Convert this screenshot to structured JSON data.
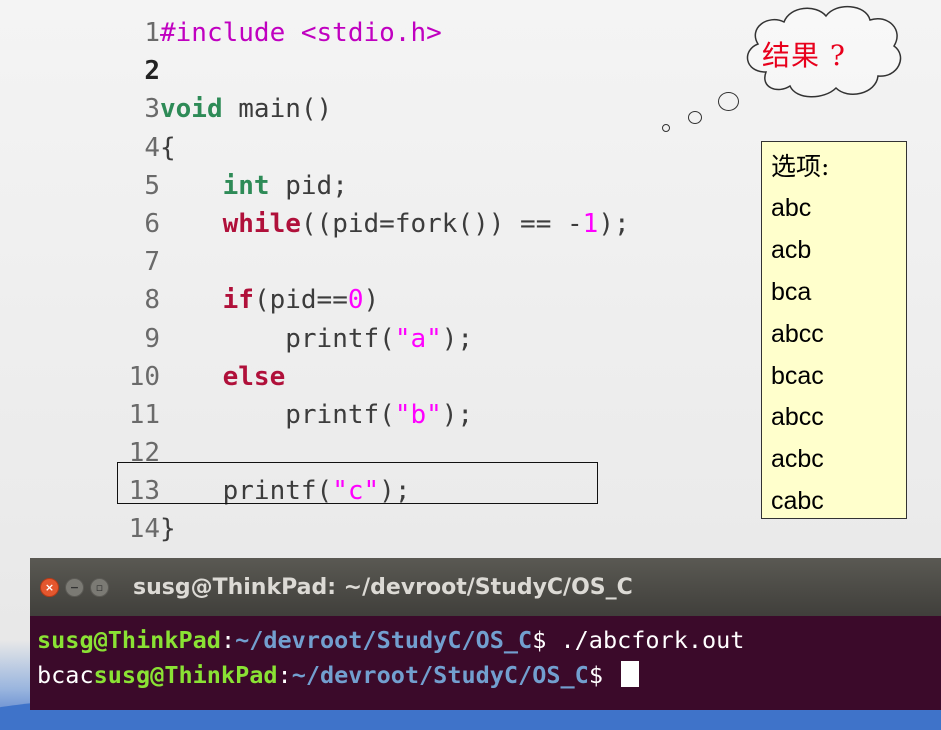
{
  "code": {
    "lines": [
      {
        "n": "1"
      },
      {
        "n": "2"
      },
      {
        "n": "3"
      },
      {
        "n": "4"
      },
      {
        "n": "5"
      },
      {
        "n": "6"
      },
      {
        "n": "7"
      },
      {
        "n": "8"
      },
      {
        "n": "9"
      },
      {
        "n": "10"
      },
      {
        "n": "11"
      },
      {
        "n": "12"
      },
      {
        "n": "13"
      },
      {
        "n": "14"
      }
    ],
    "l1": {
      "pp": "#include <stdio.h>"
    },
    "l3": {
      "kw": "void",
      "rest": " main()"
    },
    "l4": {
      "text": "{"
    },
    "l5": {
      "indent": "    ",
      "kw": "int",
      "rest": " pid;"
    },
    "l6": {
      "indent": "    ",
      "kw": "while",
      "a": "((pid=fork()) == -",
      "num": "1",
      "b": ");"
    },
    "l8": {
      "indent": "    ",
      "kw": "if",
      "a": "(pid==",
      "num": "0",
      "b": ")"
    },
    "l9": {
      "indent": "        ",
      "a": "printf(",
      "str": "\"a\"",
      "b": ");"
    },
    "l10": {
      "indent": "    ",
      "kw": "else"
    },
    "l11": {
      "indent": "        ",
      "a": "printf(",
      "str": "\"b\"",
      "b": ");"
    },
    "l13": {
      "indent": "    ",
      "a": "printf(",
      "str": "\"c\"",
      "b": ");"
    },
    "l14": {
      "text": "}"
    }
  },
  "thought": {
    "text": "结果 ?"
  },
  "options": {
    "title": "选项:",
    "items": [
      "abc",
      "acb",
      "bca",
      "abcc",
      "bcac",
      "abcc",
      "acbc",
      "cabc"
    ]
  },
  "terminal": {
    "title": "susg@ThinkPad: ~/devroot/StudyC/OS_C",
    "line1": {
      "user": "susg@ThinkPad",
      "colon": ":",
      "path": "~/devroot/StudyC/OS_C",
      "cmd": "$ ./abcfork.out"
    },
    "line2": {
      "output": "bcac",
      "user": "susg@ThinkPad",
      "colon": ":",
      "path": "~/devroot/StudyC/OS_C",
      "prompt": "$ "
    }
  },
  "colors": {
    "keyword": "#b0103a",
    "type": "#2e8b57",
    "preprocessor": "#c000c0",
    "string": "#ff00ff",
    "cloud_text": "#e8001c",
    "options_bg": "#ffffcc",
    "terminal_bg": "#3b0a2a"
  }
}
